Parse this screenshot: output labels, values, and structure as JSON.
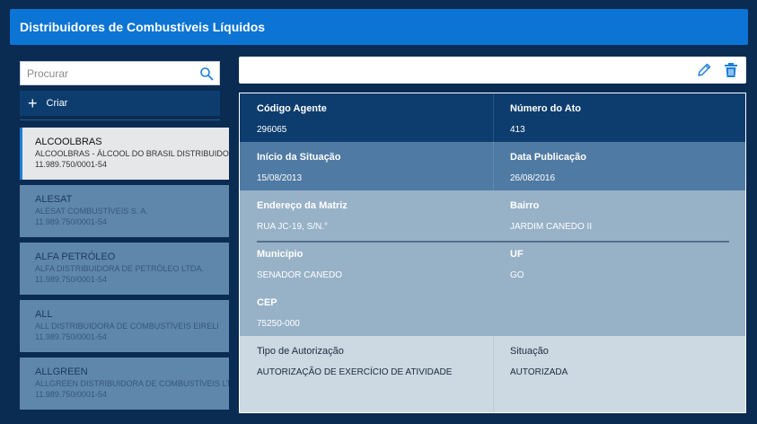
{
  "header": {
    "title": "Distribuidores de Combustíveis Líquidos"
  },
  "search": {
    "placeholder": "Procurar"
  },
  "create_label": "Criar",
  "list": [
    {
      "name": "ALCOOLBRAS",
      "sub": "ALCOOLBRAS - ÁLCOOL DO BRASIL DISTRIBUIDORA",
      "cnpj": "11.989.750/0001-54",
      "selected": true
    },
    {
      "name": "ALESAT",
      "sub": "ALESAT COMBUSTÍVEIS S. A.",
      "cnpj": "11.989.750/0001-54"
    },
    {
      "name": "ALFA PETRÓLEO",
      "sub": "ALFA DISTRIBUIDORA DE PETRÓLEO LTDA.",
      "cnpj": "11.989.750/0001-54"
    },
    {
      "name": "ALL",
      "sub": "ALL DISTRIBUIDORA DE COMBUSTÍVEIS EIRELI",
      "cnpj": "11.989.750/0001-54"
    },
    {
      "name": "ALLGREEN",
      "sub": "ALLGREEN DISTRIBUIDORA DE COMBUSTÍVEIS LTDA.",
      "cnpj": "11.989.750/0001-54"
    }
  ],
  "detail": {
    "codigo_agente": {
      "label": "Código Agente",
      "value": "296065"
    },
    "numero_ato": {
      "label": "Número do Ato",
      "value": "413"
    },
    "inicio_situacao": {
      "label": "Início da Situação",
      "value": "15/08/2013"
    },
    "data_publicacao": {
      "label": "Data Publicação",
      "value": "26/08/2016"
    },
    "endereco": {
      "label": "Endereço da Matriz",
      "value": "RUA JC-19, S/N.°"
    },
    "bairro": {
      "label": "Bairro",
      "value": "JARDIM CANEDO II"
    },
    "municipio": {
      "label": "Município",
      "value": "SENADOR CANEDO"
    },
    "uf": {
      "label": "UF",
      "value": "GO"
    },
    "cep": {
      "label": "CEP",
      "value": "75250-000"
    },
    "tipo_autorizacao": {
      "label": "Tipo de Autorização",
      "value": "AUTORIZAÇÃO DE EXERCÍCIO DE ATIVIDADE"
    },
    "situacao": {
      "label": "Situação",
      "value": "AUTORIZADA"
    }
  },
  "colors": {
    "background": "#0a2b52",
    "header": "#0b74d4",
    "band_dark": "#0c3d6e",
    "band_mid": "#4f7aa3",
    "band_light": "#97b1c7",
    "band_lightest": "#ccd8e2"
  },
  "icons": [
    "search-icon",
    "plus-icon",
    "pencil-icon",
    "trash-icon"
  ]
}
